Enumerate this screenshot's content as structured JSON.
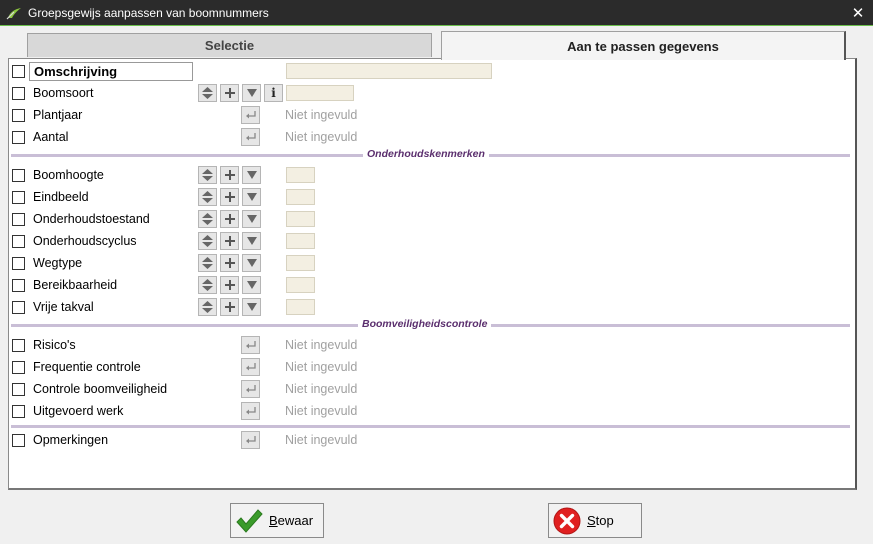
{
  "window": {
    "title": "Groepsgewijs aanpassen van boomnummers",
    "close_glyph": "✕"
  },
  "tabs": [
    {
      "label": "Selectie",
      "active": false
    },
    {
      "label": "Aan te passen gegevens",
      "active": true
    }
  ],
  "rows": {
    "omschrijving": {
      "label": "Omschrijving",
      "value": ""
    },
    "boomsoort": {
      "label": "Boomsoort",
      "value": ""
    },
    "plantjaar": {
      "label": "Plantjaar",
      "value": "Niet ingevuld"
    },
    "aantal": {
      "label": "Aantal",
      "value": "Niet ingevuld"
    },
    "boomhoogte": {
      "label": "Boomhoogte"
    },
    "eindbeeld": {
      "label": "Eindbeeld"
    },
    "onderhoudstoestand": {
      "label": "Onderhoudstoestand"
    },
    "onderhoudscyclus": {
      "label": "Onderhoudscyclus"
    },
    "wegtype": {
      "label": "Wegtype"
    },
    "bereikbaarheid": {
      "label": "Bereikbaarheid"
    },
    "vrije_takval": {
      "label": "Vrije takval"
    },
    "risicos": {
      "label": "Risico's",
      "value": "Niet ingevuld"
    },
    "frequentie_controle": {
      "label": "Frequentie controle",
      "value": "Niet ingevuld"
    },
    "controle_boomveiligheid": {
      "label": "Controle boomveiligheid",
      "value": "Niet ingevuld"
    },
    "uitgevoerd_werk": {
      "label": "Uitgevoerd werk",
      "value": "Niet ingevuld"
    },
    "opmerkingen": {
      "label": "Opmerkingen",
      "value": "Niet ingevuld"
    }
  },
  "sections": {
    "onderhoud": "Onderhoudskenmerken",
    "veiligheid": "Boomveiligheidscontrole"
  },
  "buttons": {
    "bewaar": {
      "accel": "B",
      "rest": "ewaar"
    },
    "stop": {
      "accel": "S",
      "rest": "top"
    }
  },
  "icons": {
    "sort": "sort-updown-icon",
    "add": "plus-icon",
    "dropdown": "triangle-down-icon",
    "info": "info-icon",
    "enter": "enter-return-icon"
  },
  "colors": {
    "titlebar": "#2b2b2b",
    "accent_line": "#6abf4b",
    "section_text": "#5b2f6e",
    "section_line": "#c9bed6",
    "field_bg": "#f3efe2",
    "save_green": "#3a9b2a",
    "stop_red": "#e02020"
  }
}
